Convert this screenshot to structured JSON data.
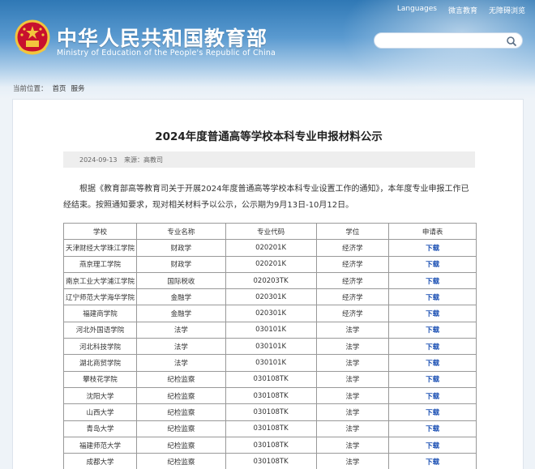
{
  "header": {
    "title_cn": "中华人民共和国教育部",
    "title_en": "Ministry of Education of the People's Republic of China",
    "top_links": [
      "Languages",
      "微言教育",
      "无障碍浏览"
    ],
    "search_placeholder": ""
  },
  "breadcrumb": {
    "prefix": "当前位置：",
    "items": [
      "首页",
      "服务"
    ]
  },
  "article": {
    "title": "2024年度普通高等学校本科专业申报材料公示",
    "date": "2024-09-13",
    "source": "来源：高教司",
    "body": "根据《教育部高等教育司关于开展2024年度普通高等学校本科专业设置工作的通知》，本年度专业申报工作已经结束。按照通知要求，现对相关材料予以公示，公示期为9月13日-10月12日。"
  },
  "table": {
    "headers": [
      "学校",
      "专业名称",
      "专业代码",
      "学位",
      "申请表"
    ],
    "rows": [
      [
        "天津财经大学珠江学院",
        "财政学",
        "020201K",
        "经济学",
        "下载"
      ],
      [
        "燕京理工学院",
        "财政学",
        "020201K",
        "经济学",
        "下载"
      ],
      [
        "南京工业大学浦江学院",
        "国际税收",
        "020203TK",
        "经济学",
        "下载"
      ],
      [
        "辽宁师范大学海华学院",
        "金融学",
        "020301K",
        "经济学",
        "下载"
      ],
      [
        "福建商学院",
        "金融学",
        "020301K",
        "经济学",
        "下载"
      ],
      [
        "河北外国语学院",
        "法学",
        "030101K",
        "法学",
        "下载"
      ],
      [
        "河北科技学院",
        "法学",
        "030101K",
        "法学",
        "下载"
      ],
      [
        "湖北商贸学院",
        "法学",
        "030101K",
        "法学",
        "下载"
      ],
      [
        "攀枝花学院",
        "纪检监察",
        "030108TK",
        "法学",
        "下载"
      ],
      [
        "沈阳大学",
        "纪检监察",
        "030108TK",
        "法学",
        "下载"
      ],
      [
        "山西大学",
        "纪检监察",
        "030108TK",
        "法学",
        "下载"
      ],
      [
        "青岛大学",
        "纪检监察",
        "030108TK",
        "法学",
        "下载"
      ],
      [
        "福建师范大学",
        "纪检监察",
        "030108TK",
        "法学",
        "下载"
      ],
      [
        "成都大学",
        "纪检监察",
        "030108TK",
        "法学",
        "下载"
      ]
    ]
  },
  "colors": {
    "header_blue": "#2f78b5",
    "link_blue": "#1a4fb3"
  }
}
